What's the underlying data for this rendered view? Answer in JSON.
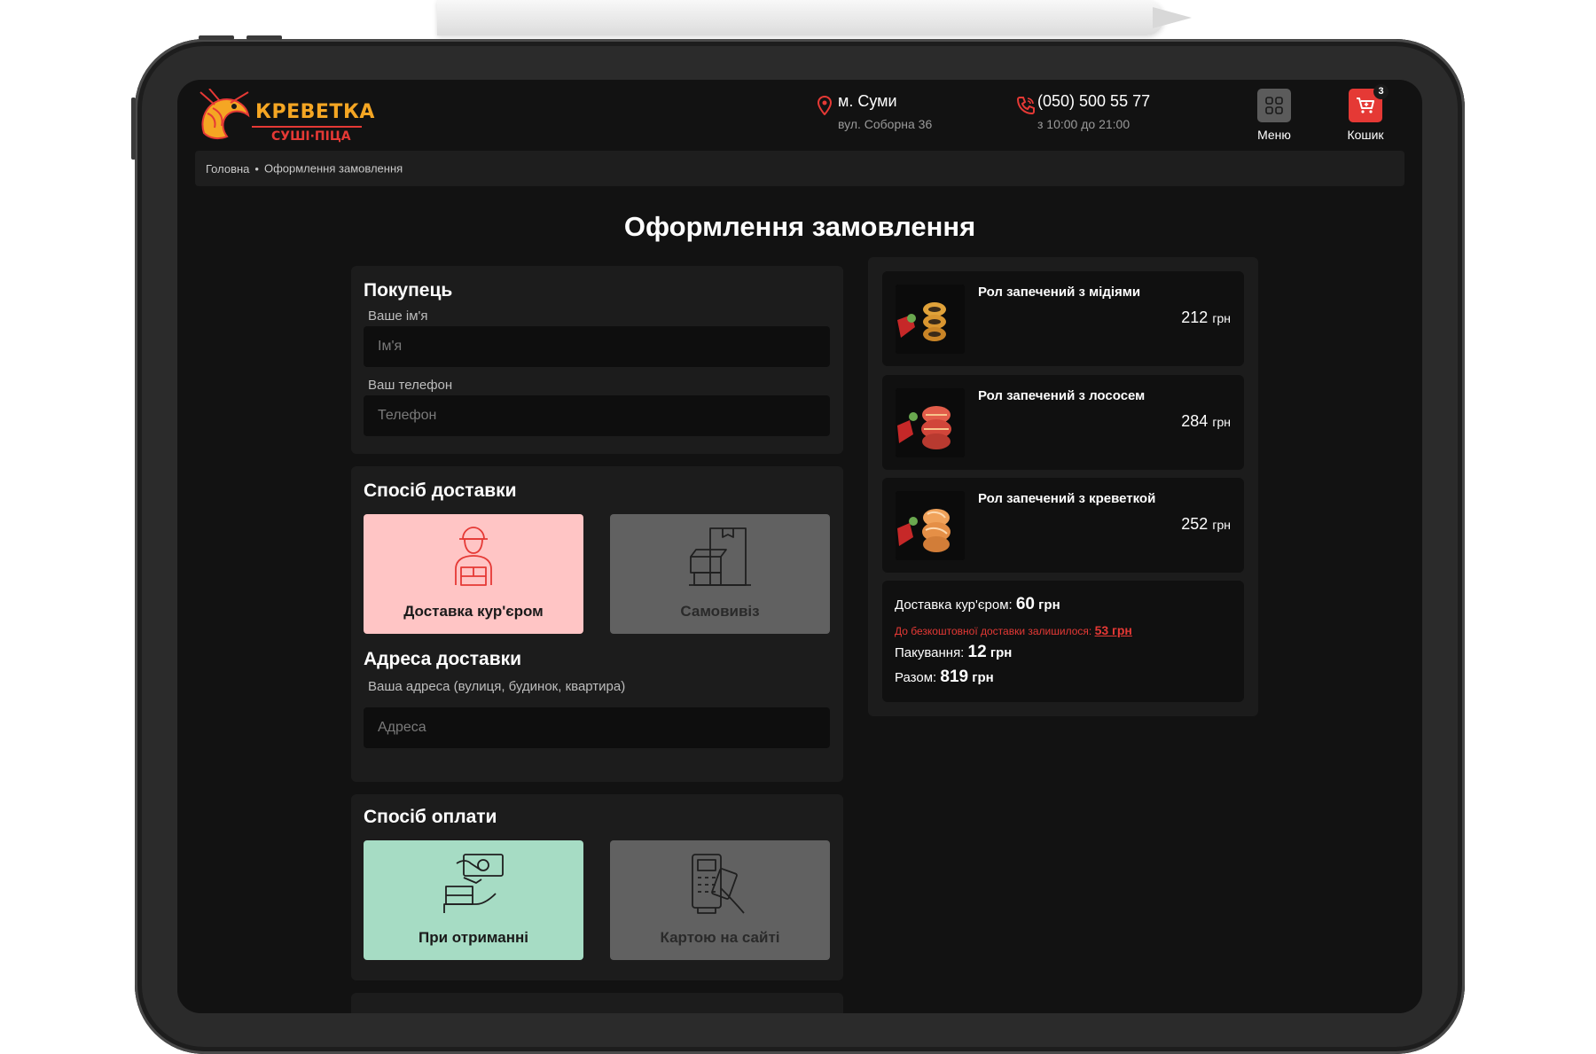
{
  "header": {
    "logo_title": "КРЕВЕТКА",
    "logo_subtitle": "СУШІ·ПІЦА",
    "city": "м. Суми",
    "street": "вул. Соборна 36",
    "phone": "(050) 500 55 77",
    "hours": "з 10:00 до 21:00",
    "menu_label": "Меню",
    "cart_label": "Кошик",
    "cart_count": "3"
  },
  "breadcrumb": {
    "home": "Головна",
    "separator": "•",
    "current": "Оформлення замовлення"
  },
  "page_title": "Оформлення замовлення",
  "buyer": {
    "title": "Покупець",
    "name_label": "Ваше ім'я",
    "name_placeholder": "Ім'я",
    "phone_label": "Ваш телефон",
    "phone_placeholder": "Телефон"
  },
  "delivery": {
    "title": "Спосіб доставки",
    "options": [
      {
        "label": "Доставка кур'єром",
        "selected": true,
        "icon": "courier-icon"
      },
      {
        "label": "Самовивіз",
        "selected": false,
        "icon": "boxes-icon"
      }
    ]
  },
  "address": {
    "title": "Адреса доставки",
    "label": "Ваша адреса (вулиця, будинок, квартира)",
    "placeholder": "Адреса"
  },
  "payment": {
    "title": "Спосіб оплати",
    "options": [
      {
        "label": "При отриманні",
        "selected": true,
        "icon": "cash-hand-icon"
      },
      {
        "label": "Картою на сайті",
        "selected": false,
        "icon": "card-terminal-icon"
      }
    ]
  },
  "cart": {
    "items": [
      {
        "name": "Рол запечений з мідіями",
        "price": "212",
        "currency": "грн"
      },
      {
        "name": "Рол запечений з лососем",
        "price": "284",
        "currency": "грн"
      },
      {
        "name": "Рол запечений з креветкой",
        "price": "252",
        "currency": "грн"
      }
    ],
    "summary": {
      "delivery_label": "Доставка кур'єром:",
      "delivery_value": "60",
      "free_delivery_label": "До безкоштовної доставки залишилося:",
      "free_delivery_value": "53 грн",
      "packaging_label": "Пакування:",
      "packaging_value": "12",
      "total_label": "Разом:",
      "total_value": "819",
      "currency": "грн"
    }
  },
  "colors": {
    "accent_red": "#e53935",
    "logo_orange": "#f5a623",
    "delivery_selected": "#ffc5c5",
    "payment_selected": "#a6dcc4",
    "option_inactive": "#616161"
  }
}
